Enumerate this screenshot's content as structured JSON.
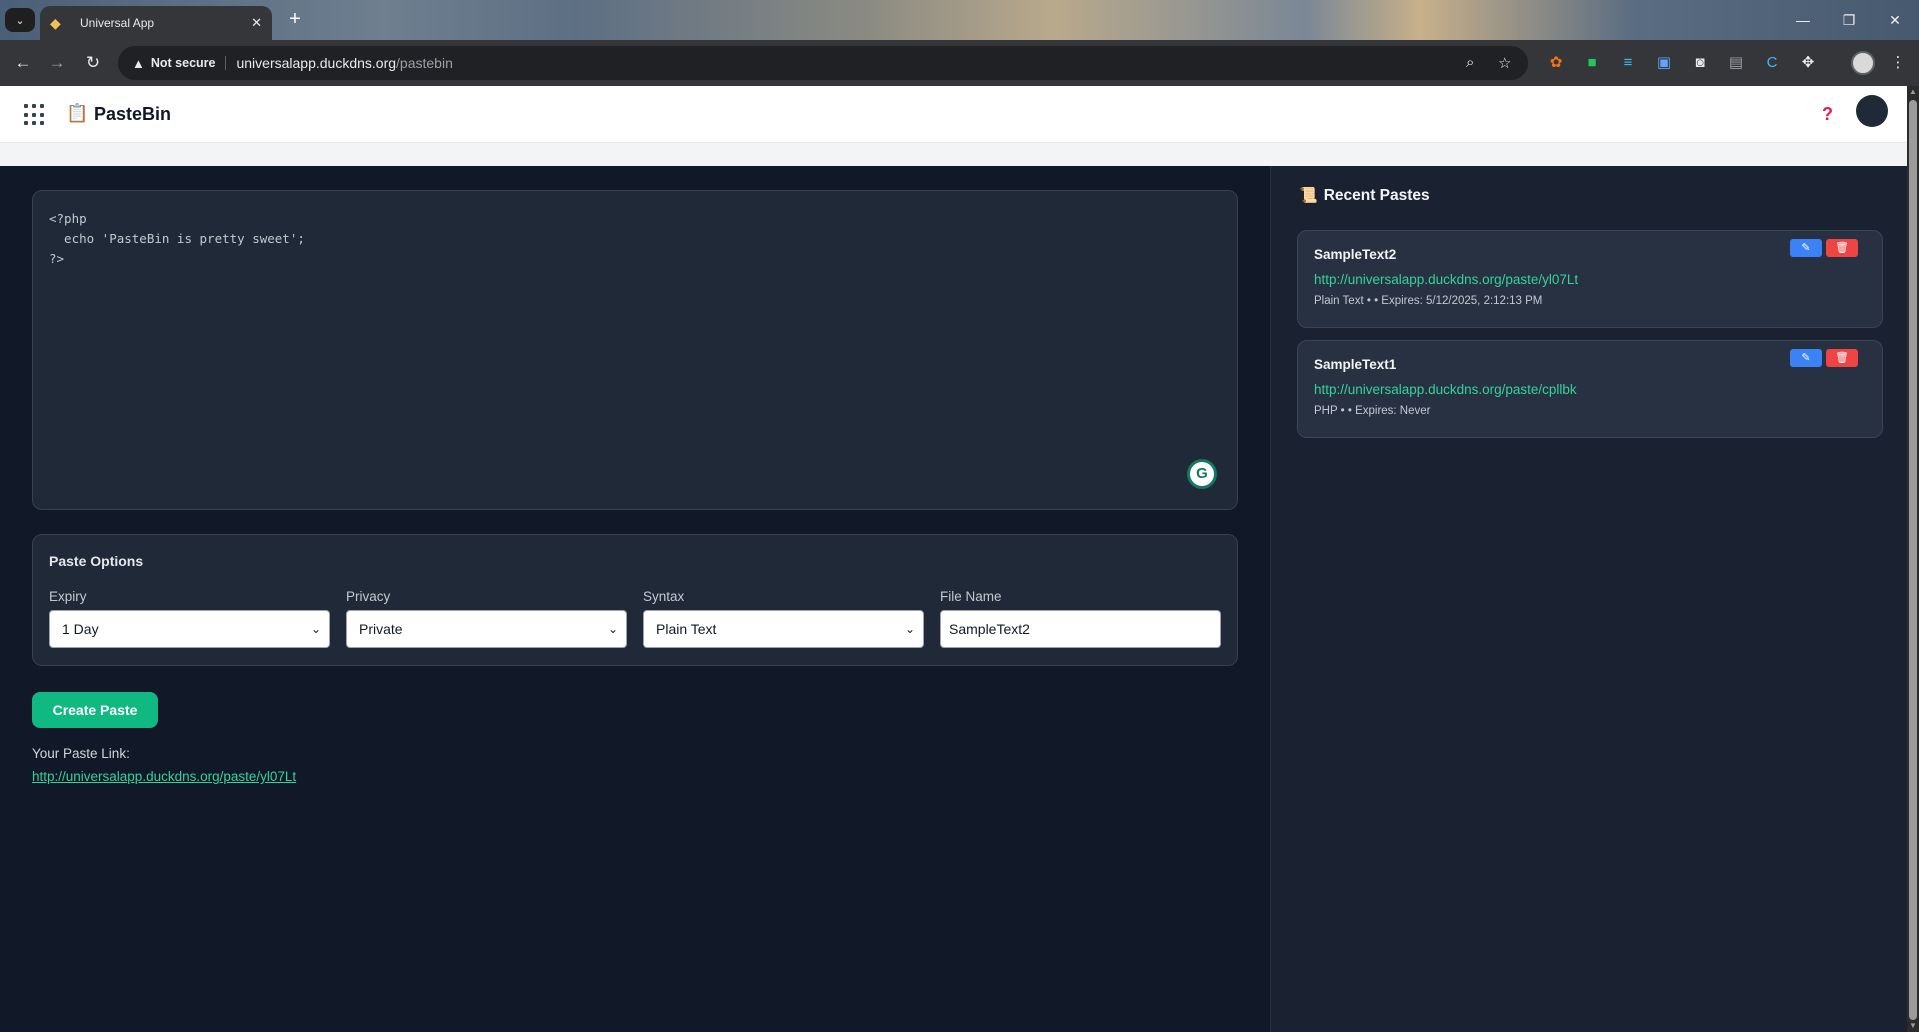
{
  "browser": {
    "tab_title": "Universal App",
    "close_tab": "✕",
    "new_tab": "+",
    "security_label": "Not secure",
    "url_host": "universalapp.duckdns.org",
    "url_path": "/pastebin",
    "window_controls": {
      "minimize": "—",
      "restore": "❐",
      "close": "✕"
    }
  },
  "app": {
    "title": "PasteBin",
    "logo_icon": "clipboard-icon",
    "help_icon": "?"
  },
  "editor": {
    "content": "<?php\n  echo 'PasteBin is pretty sweet';\n?>",
    "assistant_badge": "G"
  },
  "options": {
    "title": "Paste Options",
    "expiry": {
      "label": "Expiry",
      "value": "1 Day"
    },
    "privacy": {
      "label": "Privacy",
      "value": "Private"
    },
    "syntax": {
      "label": "Syntax",
      "value": "Plain Text"
    },
    "file_name": {
      "label": "File Name",
      "value": "SampleText2"
    }
  },
  "actions": {
    "create_label": "Create Paste",
    "link_label": "Your Paste Link:",
    "link_value": "http://universalapp.duckdns.org/paste/yl07Lt"
  },
  "recent": {
    "title": "Recent Pastes",
    "pastes": [
      {
        "name": "SampleText2",
        "url": "http://universalapp.duckdns.org/paste/yl07Lt",
        "meta": "Plain Text • • Expires: 5/12/2025, 2:12:13 PM"
      },
      {
        "name": "SampleText1",
        "url": "http://universalapp.duckdns.org/paste/cpllbk",
        "meta": "PHP • • Expires: Never"
      }
    ]
  },
  "colors": {
    "accent_green": "#10b981",
    "link_green": "#34d399",
    "edit_blue": "#3b82f6",
    "delete_red": "#ef4444",
    "page_bg": "#111827"
  }
}
